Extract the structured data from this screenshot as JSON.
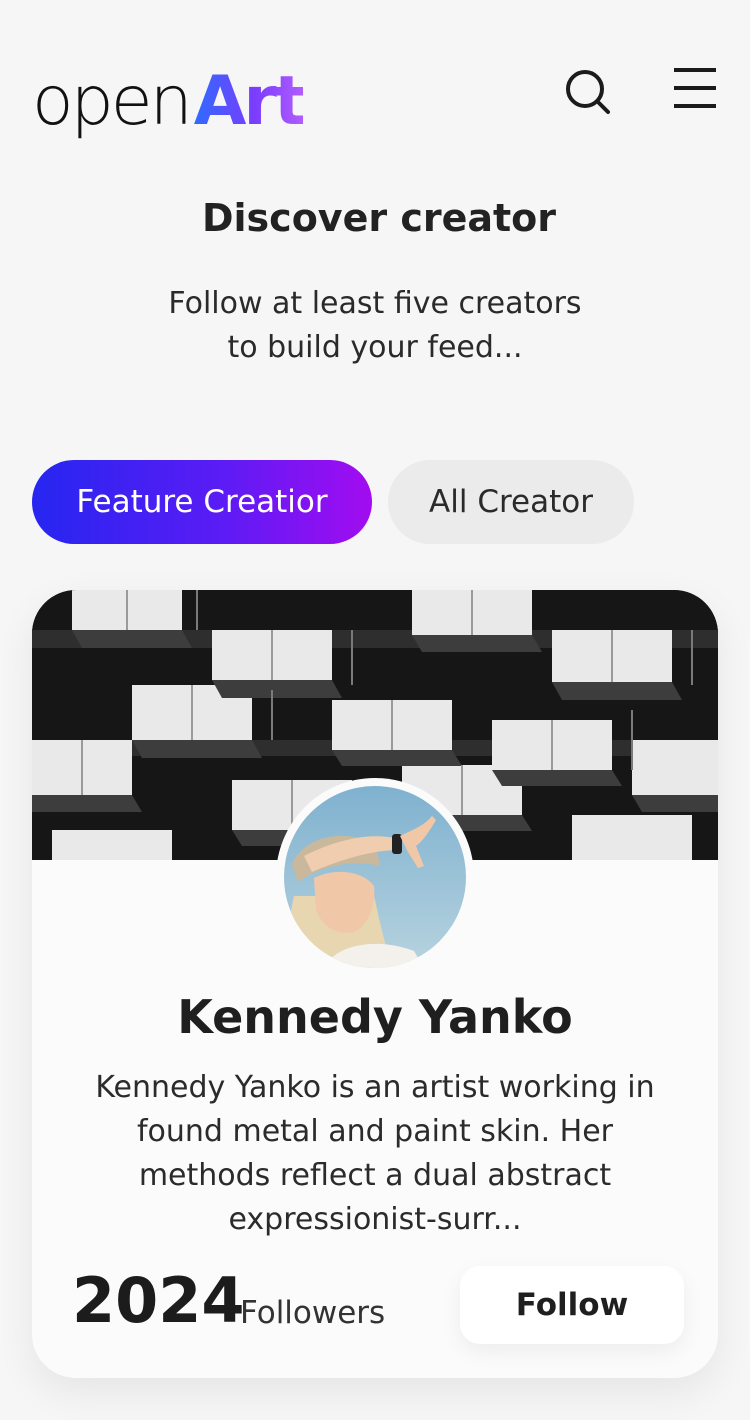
{
  "header": {
    "logo_open": "open",
    "logo_art": "Art",
    "search_icon": "search-icon",
    "menu_icon": "hamburger-menu-icon"
  },
  "intro": {
    "title": "Discover creator",
    "subtitle_lines": [
      "Follow at least five creators",
      "to build your feed..."
    ]
  },
  "tabs": [
    {
      "label": "Feature Creatior",
      "active": true
    },
    {
      "label": "All Creator",
      "active": false
    }
  ],
  "creator_card": {
    "name": "Kennedy Yanko",
    "bio_lines": [
      "Kennedy Yanko is an artist working in",
      "found metal and paint skin. Her",
      "methods reflect a dual abstract",
      "expressionist-surr..."
    ],
    "followers_count": "2024",
    "followers_label": "Followers",
    "follow_label": "Follow"
  },
  "colors": {
    "background": "#f6f6f6",
    "accent_gradient_start": "#2626f0",
    "accent_gradient_end": "#a20cf0",
    "card": "#fbfbfb"
  }
}
